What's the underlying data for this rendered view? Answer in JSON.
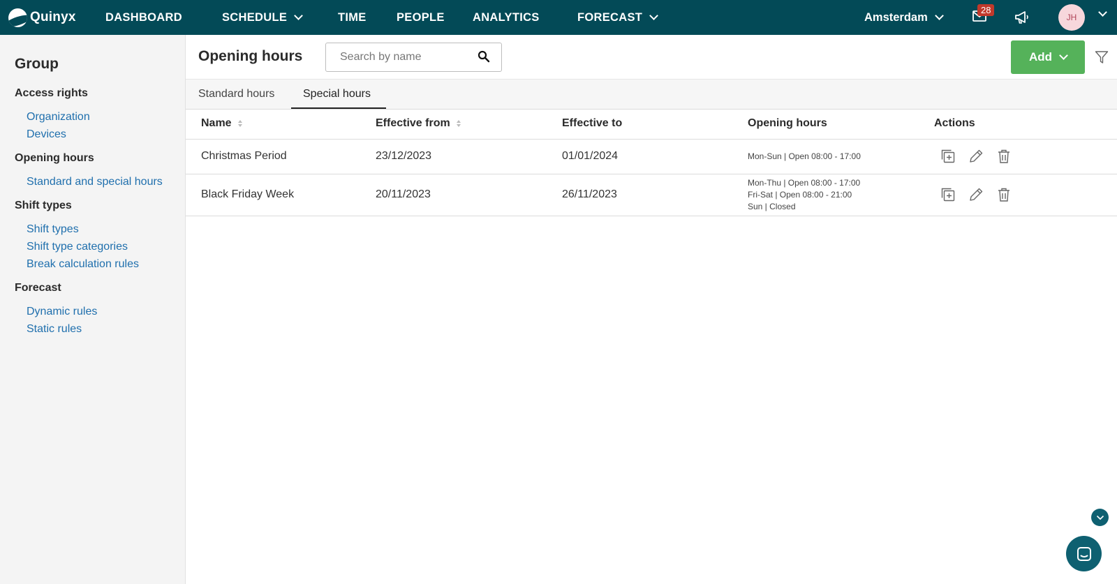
{
  "nav": {
    "logo_text": "Quinyx",
    "items": [
      {
        "label": "DASHBOARD"
      },
      {
        "label": "SCHEDULE"
      },
      {
        "label": "TIME"
      },
      {
        "label": "PEOPLE"
      },
      {
        "label": "ANALYTICS"
      },
      {
        "label": "FORECAST"
      }
    ],
    "location": "Amsterdam",
    "notification_count": "28",
    "avatar_initials": "JH"
  },
  "sidebar": {
    "title": "Group",
    "sections": [
      {
        "label": "Access rights",
        "links": [
          "Organization",
          "Devices"
        ]
      },
      {
        "label": "Opening hours",
        "links": [
          "Standard and special hours"
        ]
      },
      {
        "label": "Shift types",
        "links": [
          "Shift types",
          "Shift type categories",
          "Break calculation rules"
        ]
      },
      {
        "label": "Forecast",
        "links": [
          "Dynamic rules",
          "Static rules"
        ]
      }
    ]
  },
  "header": {
    "title": "Opening hours",
    "search_placeholder": "Search by name",
    "add_label": "Add"
  },
  "tabs": [
    {
      "label": "Standard hours",
      "active": false
    },
    {
      "label": "Special hours",
      "active": true
    }
  ],
  "table": {
    "columns": [
      "Name",
      "Effective from",
      "Effective to",
      "Opening hours",
      "Actions"
    ],
    "rows": [
      {
        "name": "Christmas Period",
        "from": "23/12/2023",
        "to": "01/01/2024",
        "hours": [
          "Mon-Sun | Open 08:00 - 17:00"
        ]
      },
      {
        "name": "Black Friday Week",
        "from": "20/11/2023",
        "to": "26/11/2023",
        "hours": [
          "Mon-Thu | Open 08:00 - 17:00",
          "Fri-Sat | Open 08:00 - 21:00",
          "Sun | Closed"
        ]
      }
    ]
  },
  "colors": {
    "nav_bg": "#034a57",
    "link": "#1f6fad",
    "add_button": "#55b25a",
    "badge": "#c0392b",
    "chat": "#0e6071"
  },
  "icons": [
    "search-icon",
    "filter-icon",
    "copy-icon",
    "edit-icon",
    "delete-icon",
    "message-icon",
    "megaphone-icon",
    "chevron-down-icon",
    "chat-icon"
  ]
}
